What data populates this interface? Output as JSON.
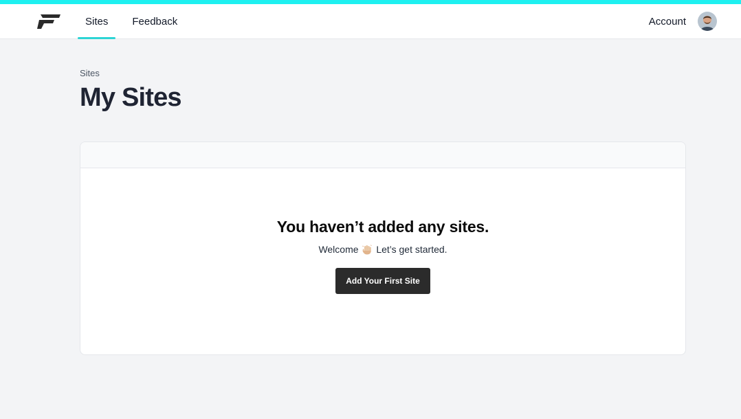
{
  "nav": {
    "logo_icon": "brand-f-logo-icon",
    "items": [
      {
        "label": "Sites",
        "active": true
      },
      {
        "label": "Feedback",
        "active": false
      }
    ],
    "account_label": "Account",
    "avatar_icon": "user-avatar"
  },
  "page": {
    "breadcrumb": "Sites",
    "title": "My Sites"
  },
  "empty_state": {
    "title": "You haven’t added any sites.",
    "welcome": "Welcome",
    "wave_icon": "waving-hand-icon",
    "started": "Let’s get started.",
    "button_label": "Add Your First Site"
  },
  "colors": {
    "accent": "#1ef0f0",
    "nav_underline": "#2dd4d4",
    "page_bg": "#f3f4f6",
    "button_bg": "#2b2b2b"
  }
}
